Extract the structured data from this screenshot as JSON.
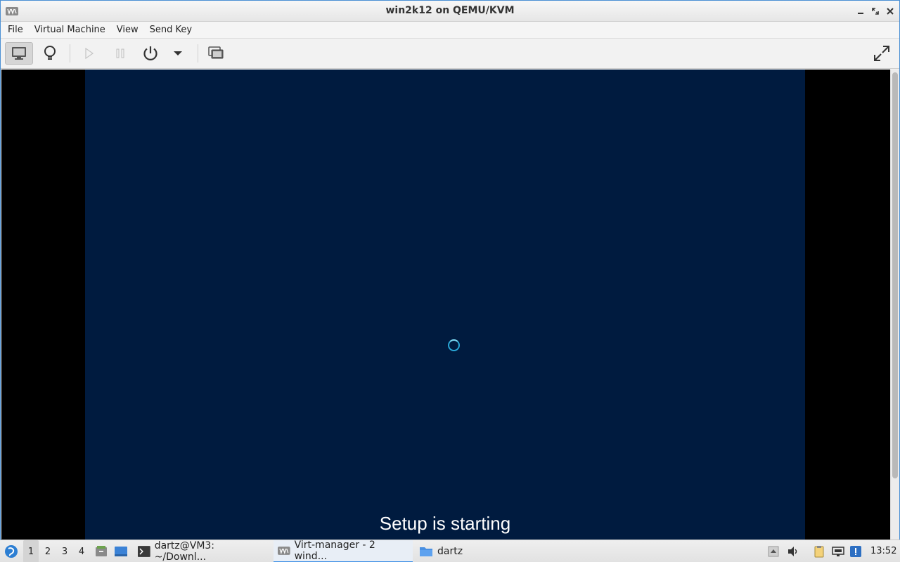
{
  "window": {
    "title": "win2k12 on QEMU/KVM"
  },
  "menubar": {
    "items": [
      "File",
      "Virtual Machine",
      "View",
      "Send Key"
    ]
  },
  "guest": {
    "status_text": "Setup is starting"
  },
  "taskbar": {
    "workspaces": [
      "1",
      "2",
      "3",
      "4"
    ],
    "tasks": [
      {
        "label": "dartz@VM3: ~/Downl...",
        "icon": "terminal-icon"
      },
      {
        "label": "Virt-manager - 2 wind...",
        "icon": "virt-manager-icon"
      },
      {
        "label": "dartz",
        "icon": "folder-icon"
      }
    ],
    "clock": "13:52"
  }
}
